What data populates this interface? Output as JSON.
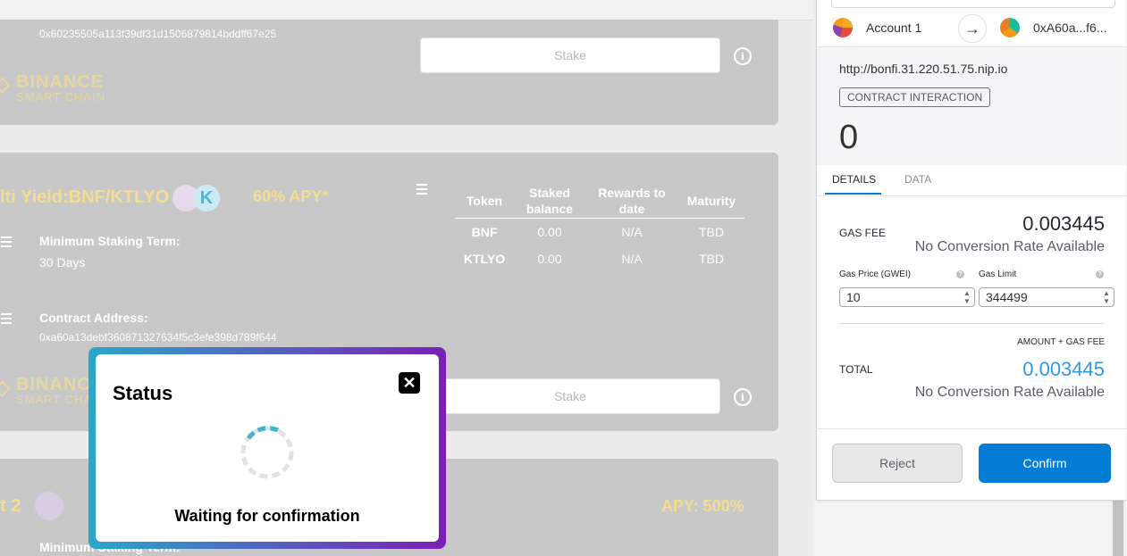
{
  "page": {
    "card1": {
      "contract_address": "0x60235505a113f39df31d1506879814bddff67e25",
      "stake_label": "Stake",
      "chain_line1": "BINANCE",
      "chain_line2": "SMART CHAIN"
    },
    "card2": {
      "pool_title": "lti Yield:BNF/KTLYO",
      "apy": "60% APY*",
      "min_term_label": "Minimum Staking Term:",
      "min_term_value": "30 Days",
      "contract_label": "Contract Address:",
      "contract_address": "0xa60a13debf360871327634f5c3efe398d789f644",
      "chain_line1": "BINANCE",
      "chain_line2": "SMART CHAIN",
      "stake_label": "Stake",
      "table": {
        "headers": [
          "Token",
          "Staked balance",
          "Rewards to date",
          "Maturity"
        ],
        "rows": [
          [
            "BNF",
            "0.00",
            "N/A",
            "TBD"
          ],
          [
            "KTLYO",
            "0.00",
            "N/A",
            "TBD"
          ]
        ]
      }
    },
    "card3": {
      "pool_title": "t 2",
      "apy": "APY: 500%",
      "min_term_label": "Minimum Staking Term:"
    }
  },
  "modal": {
    "title": "Status",
    "close_icon": "close-icon",
    "message": "Waiting for confirmation"
  },
  "wallet": {
    "account_name": "Account 1",
    "to_address": "0xA60a...f6...",
    "origin": "http://bonfi.31.220.51.75.nip.io",
    "badge": "CONTRACT INTERACTION",
    "amount": "0",
    "tabs": [
      "DETAILS",
      "DATA"
    ],
    "gas_fee_label": "GAS FEE",
    "gas_fee_value": "0.003445",
    "no_conversion": "No Conversion Rate Available",
    "gas_price_label": "Gas Price (GWEI)",
    "gas_price_value": "10",
    "gas_limit_label": "Gas Limit",
    "gas_limit_value": "344499",
    "amount_gas_label": "AMOUNT + GAS FEE",
    "total_label": "TOTAL",
    "total_value": "0.003445",
    "total_no_conversion": "No Conversion Rate Available",
    "reject_label": "Reject",
    "confirm_label": "Confirm",
    "accent_color": "#037dd6"
  }
}
